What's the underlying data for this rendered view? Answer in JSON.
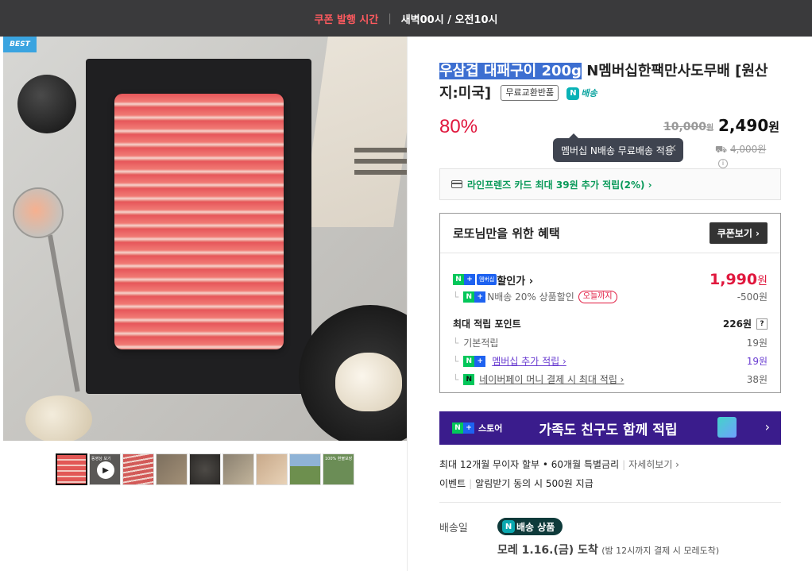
{
  "topbar": {
    "coupon_label": "쿠폰 발행 시간",
    "hours": "새벽00시 / 오전10시"
  },
  "gallery": {
    "badge": "BEST",
    "thumbs": [
      {
        "label": ""
      },
      {
        "label": "동영상 보기"
      },
      {
        "label": ""
      },
      {
        "label": ""
      },
      {
        "label": ""
      },
      {
        "label": ""
      },
      {
        "label": ""
      },
      {
        "label": ""
      },
      {
        "label": "100% 환불보장"
      }
    ]
  },
  "product": {
    "title_highlight": "우삼겹 대패구이 200g",
    "title_rest": " N멤버십한팩만사도무배 [원산지:미국]",
    "exchange_tag": "무료교환반품",
    "nship_label": "배송",
    "discount": "80%",
    "original_price": "10,000",
    "original_unit": "원",
    "sale_price": "2,490",
    "sale_unit": "원",
    "tooltip": "멤버십 N배송 무료배송 적용",
    "ship_fee_prefix": "",
    "ship_fee": "4,000원"
  },
  "card_offer": "라인프렌즈 카드 최대 39원 추가 적립(2%) ›",
  "benefit": {
    "title": "로또님만을 위한 혜택",
    "coupon_button": "쿠폰보기 ›",
    "member_price_label": "할인가 ›",
    "member_badge": "멤버십",
    "member_price": "1,990",
    "member_price_unit": "원",
    "nship_discount_label": "N배송 20% 상품할인",
    "today_only": "오늘까지",
    "nship_discount_value": "-500원",
    "points_label": "최대 적립 포인트",
    "points_value": "226원",
    "points_help": "?",
    "basic_label": "기본적립",
    "basic_value": "19원",
    "membership_label": "멤버십 추가 적립 ›",
    "membership_value": "19원",
    "npay_label": "네이버페이 머니 결제 시 최대 적립 ›",
    "npay_value": "38원"
  },
  "promo": {
    "store": "스토어",
    "text": "가족도 친구도 함께 적립",
    "arrow": "›"
  },
  "installment": {
    "text": "최대 12개월 무이자 할부 • 60개월 특별금리",
    "more": "자세히보기 ›"
  },
  "event": {
    "label": "이벤트",
    "text": "알림받기 동의 시 500원 지급"
  },
  "delivery": {
    "label": "배송일",
    "pill": "배송 상품",
    "arrival_main": "모레 1.16.(금) 도착",
    "arrival_note": "(밤 12시까지 결제 시 모레도착)"
  }
}
